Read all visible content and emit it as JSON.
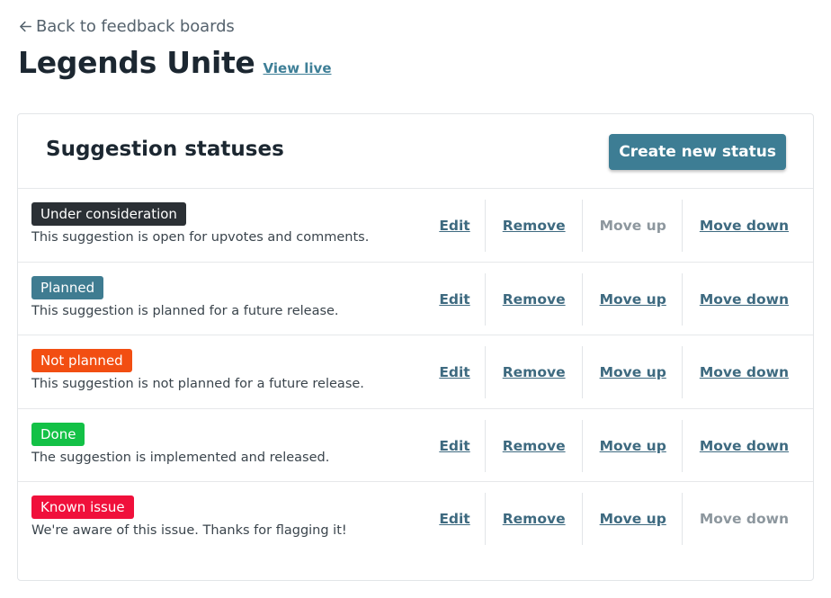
{
  "nav": {
    "back_label": "Back to feedback boards"
  },
  "header": {
    "title": "Legends Unite",
    "view_live": "View live"
  },
  "section": {
    "title": "Suggestion statuses",
    "create_button": "Create new status"
  },
  "actions": {
    "edit": "Edit",
    "remove": "Remove",
    "move_up": "Move up",
    "move_down": "Move down"
  },
  "statuses": [
    {
      "name": "Under consideration",
      "description": "This suggestion is open for upvotes and comments.",
      "color": "#2b3035",
      "move_up_enabled": false,
      "move_down_enabled": true
    },
    {
      "name": "Planned",
      "description": "This suggestion is planned for a future release.",
      "color": "#3f7c91",
      "move_up_enabled": true,
      "move_down_enabled": true
    },
    {
      "name": "Not planned",
      "description": "This suggestion is not planned for a future release.",
      "color": "#f24e12",
      "move_up_enabled": true,
      "move_down_enabled": true
    },
    {
      "name": "Done",
      "description": "The suggestion is implemented and released.",
      "color": "#13c146",
      "move_up_enabled": true,
      "move_down_enabled": true
    },
    {
      "name": "Known issue",
      "description": "We're aware of this issue. Thanks for flagging it!",
      "color": "#f0103b",
      "move_up_enabled": true,
      "move_down_enabled": false
    }
  ]
}
